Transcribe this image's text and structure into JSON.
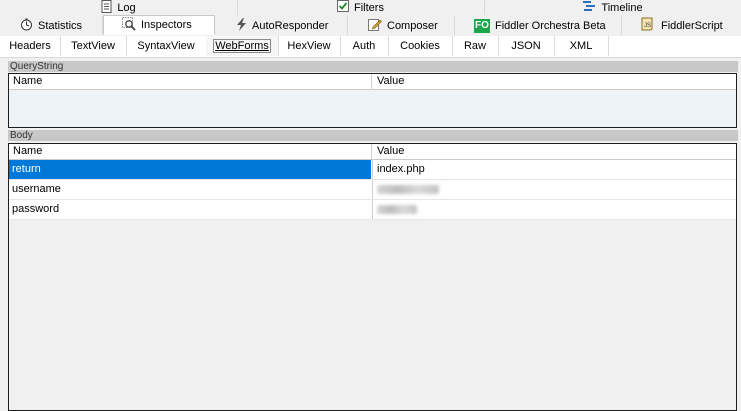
{
  "top_tabs": {
    "log": "Log",
    "filters": "Filters",
    "timeline": "Timeline"
  },
  "main_tabs": {
    "statistics": "Statistics",
    "inspectors": "Inspectors",
    "autoresponder": "AutoResponder",
    "composer": "Composer",
    "orchestra": "Fiddler Orchestra Beta",
    "orchestra_badge": "FO",
    "fiddlerscript": "FiddlerScript",
    "fiddlerscript_badge": "JS"
  },
  "sub_tabs": [
    "Headers",
    "TextView",
    "SyntaxView",
    "WebForms",
    "HexView",
    "Auth",
    "Cookies",
    "Raw",
    "JSON",
    "XML"
  ],
  "querystring": {
    "title": "QueryString",
    "col_name": "Name",
    "col_value": "Value"
  },
  "body": {
    "title": "Body",
    "col_name": "Name",
    "col_value": "Value",
    "rows": [
      {
        "name": "return",
        "value": "index.php"
      },
      {
        "name": "username",
        "value": ""
      },
      {
        "name": "password",
        "value": ""
      }
    ]
  },
  "colors": {
    "selection": "#0078d7",
    "orchestra_green": "#1aa64a"
  }
}
